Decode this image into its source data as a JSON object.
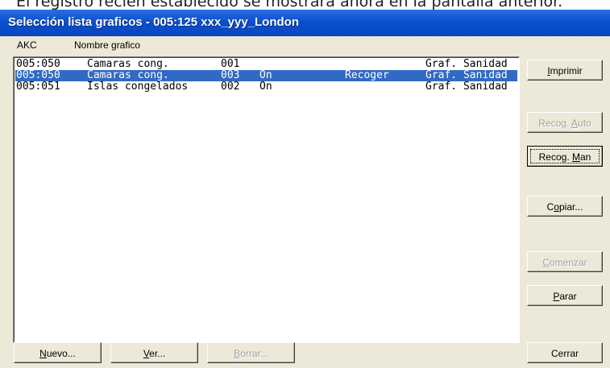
{
  "caption": "El registro recién establecido se mostrará ahora en la pantalla anterior.",
  "window": {
    "title": "Selección lista graficos - 005:125  xxx_yyy_London"
  },
  "headers": [
    "AKC",
    "Nombre grafico"
  ],
  "rows": [
    {
      "akc": "005:050",
      "name": "Camaras cong.",
      "num": "001",
      "state": "",
      "action": "",
      "type": "Graf. Sanidad",
      "selected": false
    },
    {
      "akc": "005:050",
      "name": "Camaras cong.",
      "num": "003",
      "state": "On",
      "action": "Recoger",
      "type": "Graf. Sanidad",
      "selected": true
    },
    {
      "akc": "005:051",
      "name": "Islas congelados",
      "num": "002",
      "state": "On",
      "action": "",
      "type": "Graf. Sanidad",
      "selected": false
    }
  ],
  "side_buttons": {
    "imprimir": {
      "pre": "",
      "key": "I",
      "post": "mprimir"
    },
    "recog_auto": {
      "pre": "Recog. ",
      "key": "A",
      "post": "uto"
    },
    "recog_man": {
      "pre": "Recog. ",
      "key": "M",
      "post": "an"
    },
    "copiar": {
      "pre": "C",
      "key": "o",
      "post": "piar..."
    },
    "comenzar": {
      "pre": "",
      "key": "C",
      "post": "omenzar"
    },
    "parar": {
      "pre": "",
      "key": "P",
      "post": "arar"
    },
    "cerrar": {
      "label": "Cerrar"
    }
  },
  "bottom_buttons": {
    "nuevo": {
      "pre": "",
      "key": "N",
      "post": "uevo..."
    },
    "ver": {
      "pre": "",
      "key": "V",
      "post": "er..."
    },
    "borrar": {
      "pre": "",
      "key": "B",
      "post": "orrar..."
    }
  }
}
